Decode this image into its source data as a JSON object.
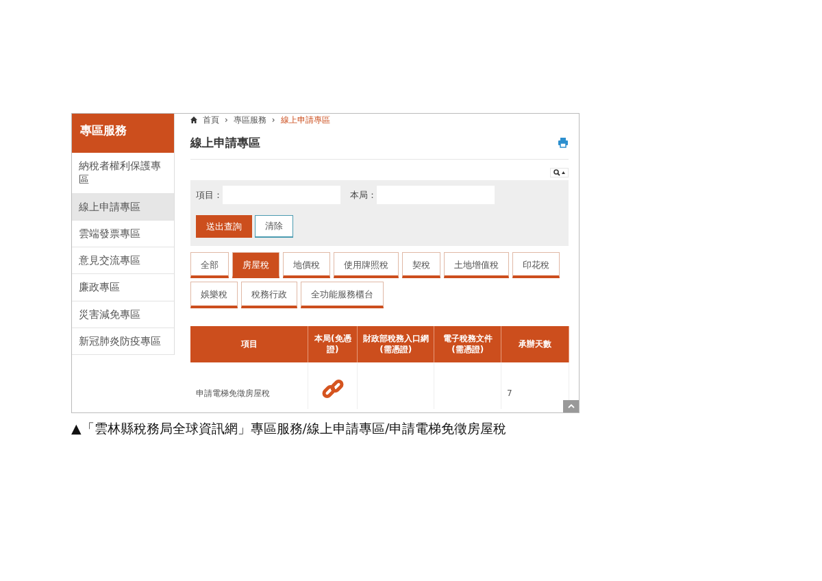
{
  "sidebar": {
    "title": "專區服務",
    "items": [
      {
        "label": "納稅者權利保護專區",
        "selected": false
      },
      {
        "label": "線上申請專區",
        "selected": true
      },
      {
        "label": "雲端發票專區",
        "selected": false
      },
      {
        "label": "意見交流專區",
        "selected": false
      },
      {
        "label": "廉政專區",
        "selected": false
      },
      {
        "label": "災害減免專區",
        "selected": false
      },
      {
        "label": "新冠肺炎防疫專區",
        "selected": false
      }
    ]
  },
  "breadcrumb": [
    {
      "label": "首頁",
      "current": false
    },
    {
      "label": "專區服務",
      "current": false
    },
    {
      "label": "線上申請專區",
      "current": true
    }
  ],
  "breadcrumb_separator": "›",
  "page_title": "線上申請專區",
  "search": {
    "fields": [
      {
        "label": "項目："
      },
      {
        "label": "本局："
      }
    ],
    "buttons": [
      {
        "label": "送出查詢",
        "kind": "primary"
      },
      {
        "label": "清除",
        "kind": "secondary"
      }
    ]
  },
  "categories": [
    {
      "label": "全部",
      "selected": false
    },
    {
      "label": "房屋稅",
      "selected": true
    },
    {
      "label": "地價稅",
      "selected": false
    },
    {
      "label": "使用牌照稅",
      "selected": false
    },
    {
      "label": "契稅",
      "selected": false
    },
    {
      "label": "土地增值稅",
      "selected": false
    },
    {
      "label": "印花稅",
      "selected": false
    },
    {
      "label": "娛樂稅",
      "selected": false
    },
    {
      "label": "稅務行政",
      "selected": false
    },
    {
      "label": "全功能服務櫃台",
      "selected": false
    }
  ],
  "table": {
    "columns": [
      "項目",
      "本局(免憑證)",
      "財政部稅務入口網(需憑證)",
      "電子稅務文件(需憑證)",
      "承辦天數"
    ],
    "rows": [
      {
        "item": "申請電梯免徵房屋稅",
        "local_link": true,
        "portal_link": false,
        "document_link": false,
        "days": "7"
      }
    ]
  },
  "caption": "▲「雲林縣稅務局全球資訊網」專區服務/線上申請專區/申請電梯免徵房屋稅"
}
